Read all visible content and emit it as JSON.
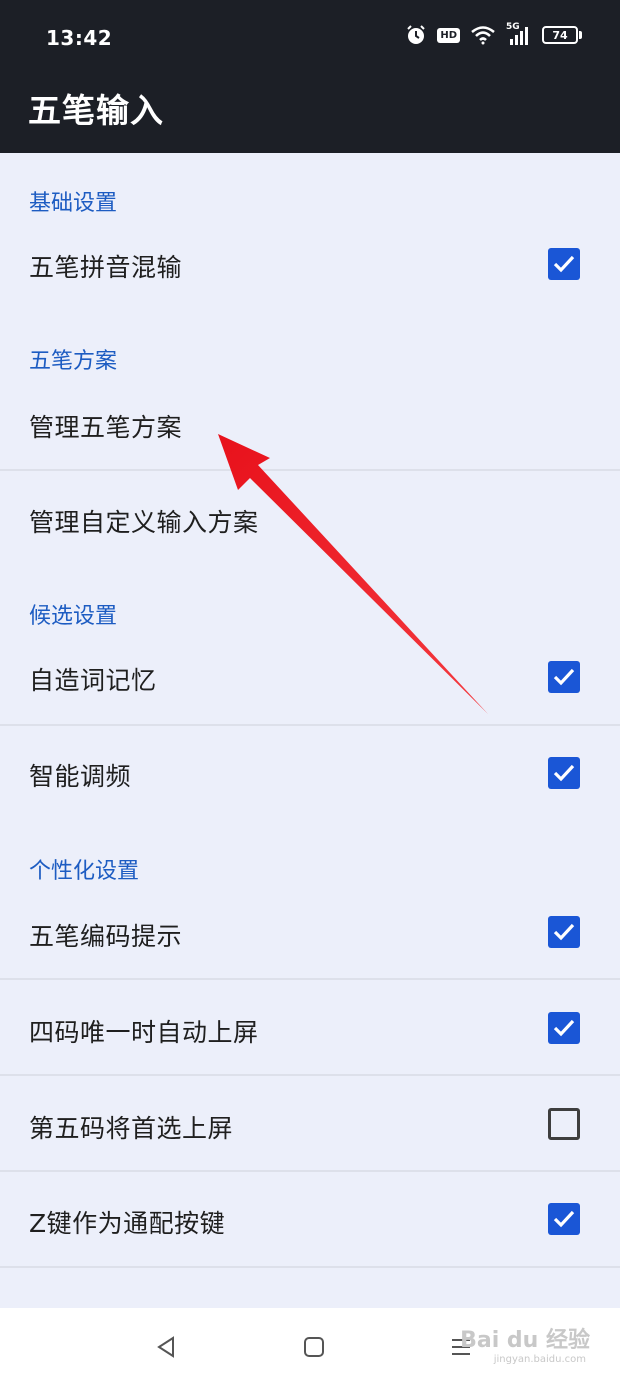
{
  "status_bar": {
    "time": "13:42",
    "icons": [
      "alarm-icon",
      "hd-icon",
      "wifi-icon",
      "signal-5g-icon",
      "battery-icon"
    ],
    "hd": "HD",
    "net": "5G",
    "battery": "74"
  },
  "app_bar": {
    "title": "五笔输入"
  },
  "sections": {
    "basic": {
      "header": "基础设置",
      "wubi_pinyin_mix": "五笔拼音混输"
    },
    "scheme": {
      "header": "五笔方案",
      "manage_wubi": "管理五笔方案",
      "manage_custom": "管理自定义输入方案"
    },
    "candidate": {
      "header": "候选设置",
      "self_word_memory": "自造词记忆",
      "smart_freq": "智能调频"
    },
    "personal": {
      "header": "个性化设置",
      "code_hint": "五笔编码提示",
      "four_code_auto": "四码唯一时自动上屏",
      "fifth_code": "第五码将首选上屏",
      "z_key": "Z键作为通配按键"
    }
  },
  "checkbox_states": {
    "wubi_pinyin_mix": true,
    "self_word_memory": true,
    "smart_freq": true,
    "code_hint": true,
    "four_code_auto": true,
    "fifth_code": false,
    "z_key": true
  },
  "colors": {
    "accent": "#1a56d6",
    "section_header": "#1d5cc2",
    "app_bar": "#1c1f26",
    "background": "#eceffa",
    "annotation_arrow": "#e8111b"
  },
  "navigation": {
    "icons": [
      "back-icon",
      "home-icon",
      "menu-icon"
    ]
  },
  "watermark": {
    "brand": "Bai du 经验",
    "url": "jingyan.baidu.com"
  }
}
